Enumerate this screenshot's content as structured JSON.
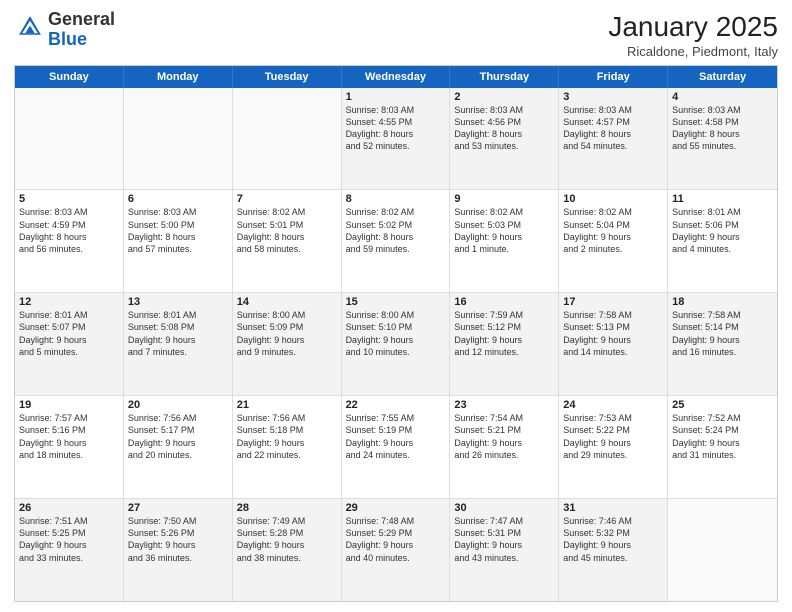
{
  "logo": {
    "general": "General",
    "blue": "Blue"
  },
  "header": {
    "month": "January 2025",
    "location": "Ricaldone, Piedmont, Italy"
  },
  "days": [
    "Sunday",
    "Monday",
    "Tuesday",
    "Wednesday",
    "Thursday",
    "Friday",
    "Saturday"
  ],
  "rows": [
    [
      {
        "day": "",
        "content": ""
      },
      {
        "day": "",
        "content": ""
      },
      {
        "day": "",
        "content": ""
      },
      {
        "day": "1",
        "content": "Sunrise: 8:03 AM\nSunset: 4:55 PM\nDaylight: 8 hours\nand 52 minutes."
      },
      {
        "day": "2",
        "content": "Sunrise: 8:03 AM\nSunset: 4:56 PM\nDaylight: 8 hours\nand 53 minutes."
      },
      {
        "day": "3",
        "content": "Sunrise: 8:03 AM\nSunset: 4:57 PM\nDaylight: 8 hours\nand 54 minutes."
      },
      {
        "day": "4",
        "content": "Sunrise: 8:03 AM\nSunset: 4:58 PM\nDaylight: 8 hours\nand 55 minutes."
      }
    ],
    [
      {
        "day": "5",
        "content": "Sunrise: 8:03 AM\nSunset: 4:59 PM\nDaylight: 8 hours\nand 56 minutes."
      },
      {
        "day": "6",
        "content": "Sunrise: 8:03 AM\nSunset: 5:00 PM\nDaylight: 8 hours\nand 57 minutes."
      },
      {
        "day": "7",
        "content": "Sunrise: 8:02 AM\nSunset: 5:01 PM\nDaylight: 8 hours\nand 58 minutes."
      },
      {
        "day": "8",
        "content": "Sunrise: 8:02 AM\nSunset: 5:02 PM\nDaylight: 8 hours\nand 59 minutes."
      },
      {
        "day": "9",
        "content": "Sunrise: 8:02 AM\nSunset: 5:03 PM\nDaylight: 9 hours\nand 1 minute."
      },
      {
        "day": "10",
        "content": "Sunrise: 8:02 AM\nSunset: 5:04 PM\nDaylight: 9 hours\nand 2 minutes."
      },
      {
        "day": "11",
        "content": "Sunrise: 8:01 AM\nSunset: 5:06 PM\nDaylight: 9 hours\nand 4 minutes."
      }
    ],
    [
      {
        "day": "12",
        "content": "Sunrise: 8:01 AM\nSunset: 5:07 PM\nDaylight: 9 hours\nand 5 minutes."
      },
      {
        "day": "13",
        "content": "Sunrise: 8:01 AM\nSunset: 5:08 PM\nDaylight: 9 hours\nand 7 minutes."
      },
      {
        "day": "14",
        "content": "Sunrise: 8:00 AM\nSunset: 5:09 PM\nDaylight: 9 hours\nand 9 minutes."
      },
      {
        "day": "15",
        "content": "Sunrise: 8:00 AM\nSunset: 5:10 PM\nDaylight: 9 hours\nand 10 minutes."
      },
      {
        "day": "16",
        "content": "Sunrise: 7:59 AM\nSunset: 5:12 PM\nDaylight: 9 hours\nand 12 minutes."
      },
      {
        "day": "17",
        "content": "Sunrise: 7:58 AM\nSunset: 5:13 PM\nDaylight: 9 hours\nand 14 minutes."
      },
      {
        "day": "18",
        "content": "Sunrise: 7:58 AM\nSunset: 5:14 PM\nDaylight: 9 hours\nand 16 minutes."
      }
    ],
    [
      {
        "day": "19",
        "content": "Sunrise: 7:57 AM\nSunset: 5:16 PM\nDaylight: 9 hours\nand 18 minutes."
      },
      {
        "day": "20",
        "content": "Sunrise: 7:56 AM\nSunset: 5:17 PM\nDaylight: 9 hours\nand 20 minutes."
      },
      {
        "day": "21",
        "content": "Sunrise: 7:56 AM\nSunset: 5:18 PM\nDaylight: 9 hours\nand 22 minutes."
      },
      {
        "day": "22",
        "content": "Sunrise: 7:55 AM\nSunset: 5:19 PM\nDaylight: 9 hours\nand 24 minutes."
      },
      {
        "day": "23",
        "content": "Sunrise: 7:54 AM\nSunset: 5:21 PM\nDaylight: 9 hours\nand 26 minutes."
      },
      {
        "day": "24",
        "content": "Sunrise: 7:53 AM\nSunset: 5:22 PM\nDaylight: 9 hours\nand 29 minutes."
      },
      {
        "day": "25",
        "content": "Sunrise: 7:52 AM\nSunset: 5:24 PM\nDaylight: 9 hours\nand 31 minutes."
      }
    ],
    [
      {
        "day": "26",
        "content": "Sunrise: 7:51 AM\nSunset: 5:25 PM\nDaylight: 9 hours\nand 33 minutes."
      },
      {
        "day": "27",
        "content": "Sunrise: 7:50 AM\nSunset: 5:26 PM\nDaylight: 9 hours\nand 36 minutes."
      },
      {
        "day": "28",
        "content": "Sunrise: 7:49 AM\nSunset: 5:28 PM\nDaylight: 9 hours\nand 38 minutes."
      },
      {
        "day": "29",
        "content": "Sunrise: 7:48 AM\nSunset: 5:29 PM\nDaylight: 9 hours\nand 40 minutes."
      },
      {
        "day": "30",
        "content": "Sunrise: 7:47 AM\nSunset: 5:31 PM\nDaylight: 9 hours\nand 43 minutes."
      },
      {
        "day": "31",
        "content": "Sunrise: 7:46 AM\nSunset: 5:32 PM\nDaylight: 9 hours\nand 45 minutes."
      },
      {
        "day": "",
        "content": ""
      }
    ]
  ]
}
